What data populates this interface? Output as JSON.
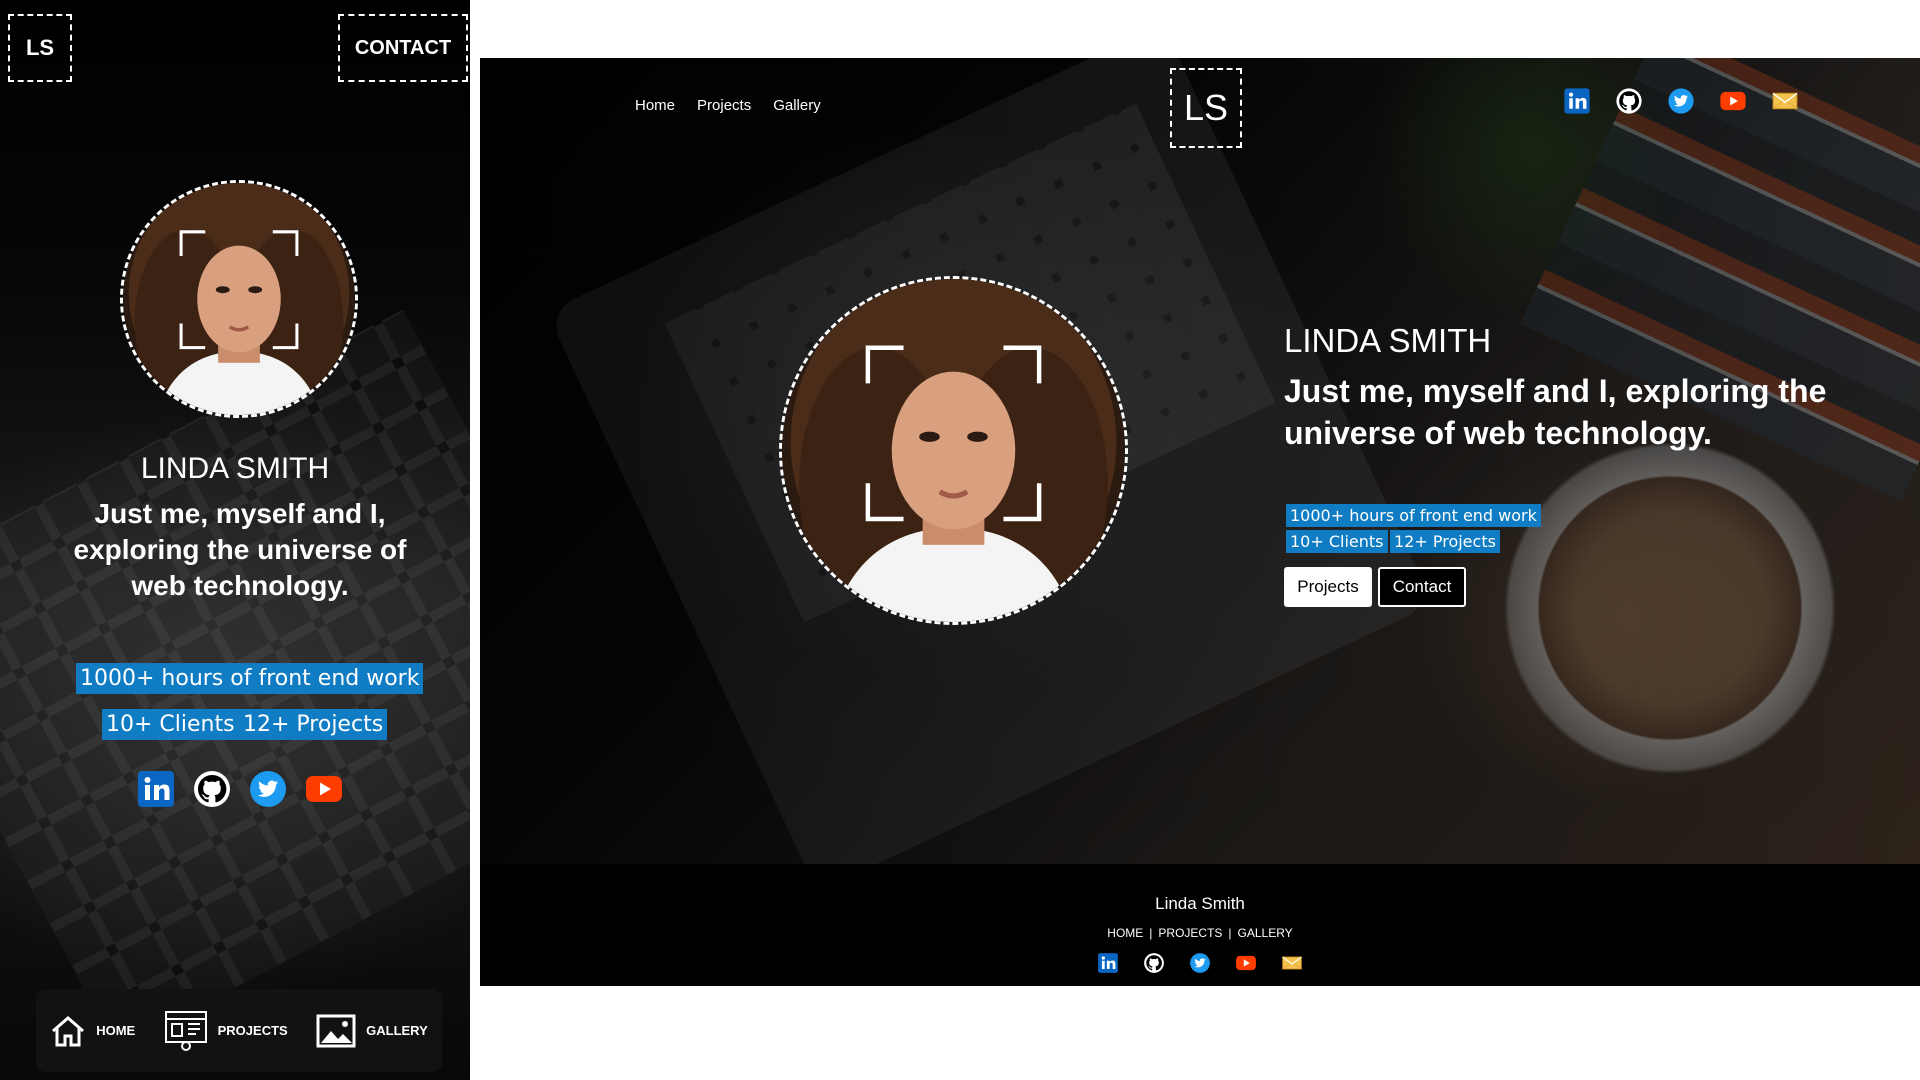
{
  "colors": {
    "badge_bg": "#0f7cc4",
    "linkedin": "#0a66c2",
    "twitter": "#1d9bf0",
    "youtube": "#ff3d00",
    "mail": "#f2c14e"
  },
  "mobile": {
    "logo": "LS",
    "contact_label": "CONTACT",
    "name": "LINDA SMITH",
    "tagline": "Just me, myself and I, exploring the universe of web technology.",
    "badges": [
      "1000+ hours of front end work",
      "10+ Clients",
      "12+ Projects"
    ],
    "social_icons": [
      "linkedin-icon",
      "github-icon",
      "twitter-icon",
      "youtube-icon"
    ],
    "bottom_nav": [
      {
        "label": "HOME",
        "icon": "home-icon"
      },
      {
        "label": "PROJECTS",
        "icon": "projects-icon"
      },
      {
        "label": "GALLERY",
        "icon": "gallery-icon"
      }
    ]
  },
  "desktop": {
    "nav": [
      "Home",
      "Projects",
      "Gallery"
    ],
    "logo": "LS",
    "social_icons": [
      "linkedin-icon",
      "github-icon",
      "twitter-icon",
      "youtube-icon",
      "mail-icon"
    ],
    "name": "LINDA SMITH",
    "tagline": "Just me, myself and I, exploring the universe of web technology.",
    "badges": [
      "1000+ hours of front end work",
      "10+ Clients",
      "12+ Projects"
    ],
    "buttons": {
      "projects": "Projects",
      "contact": "Contact"
    },
    "footer": {
      "name": "Linda Smith",
      "links": [
        "HOME",
        "PROJECTS",
        "GALLERY"
      ],
      "separator": "|",
      "social_icons": [
        "linkedin-icon",
        "github-icon",
        "twitter-icon",
        "youtube-icon",
        "mail-icon"
      ]
    }
  }
}
